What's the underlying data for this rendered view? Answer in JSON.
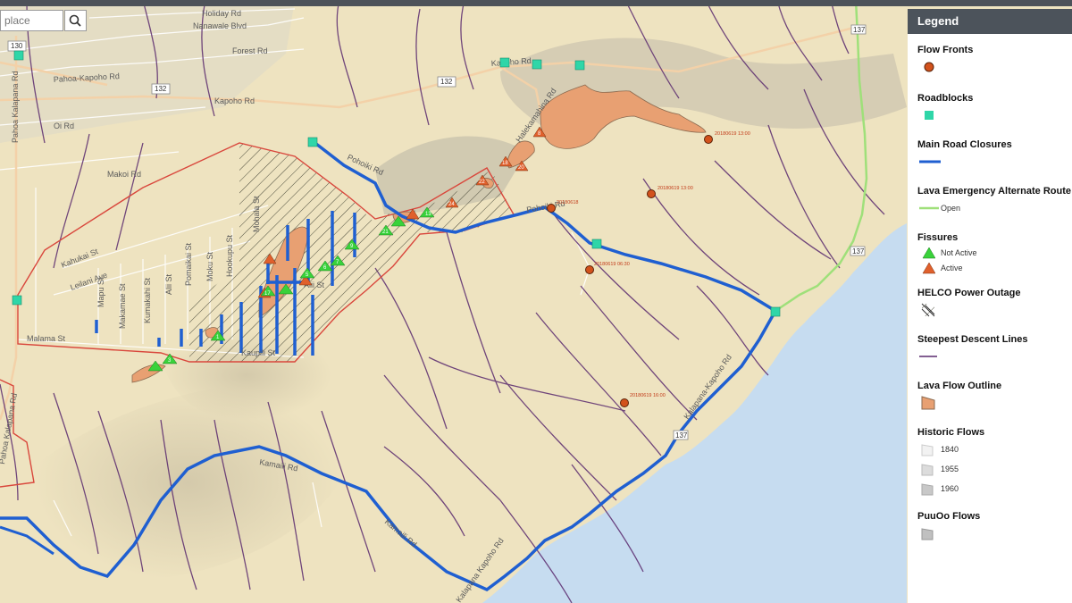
{
  "search": {
    "placeholder": "place"
  },
  "legend": {
    "title": "Legend",
    "flow_fronts": "Flow Fronts",
    "roadblocks": "Roadblocks",
    "main_road_closures": "Main Road Closures",
    "alternate_route": "Lava Emergency Alternate Route",
    "alternate_route_open": "Open",
    "fissures": "Fissures",
    "fissures_not_active": "Not Active",
    "fissures_active": "Active",
    "helco": "HELCO Power Outage",
    "steepest": "Steepest Descent Lines",
    "lava_outline": "Lava Flow Outline",
    "historic_flows": "Historic Flows",
    "historic_1840": "1840",
    "historic_1955": "1955",
    "historic_1960": "1960",
    "puuoo": "PuuOo Flows"
  },
  "colors": {
    "land": "#eee3c0",
    "ocean": "#c6dcf0",
    "road_closure": "#1f5fd1",
    "alt_route": "#9fe07a",
    "roadblock": "#2fd6a8",
    "flow_front": "#d2521c",
    "lava": "#e8a072",
    "fissure_not_active": "#39d23b",
    "fissure_active": "#e0602c",
    "helco_outline": "#d9473c",
    "steepest": "#5a2a6e"
  },
  "map": {
    "roads": {
      "holiday_rd": "Holiday Rd",
      "nanawale": "Nanawale Blvd",
      "forest": "Forest Rd",
      "pahoa_kapoho": "Pahoa-Kapoho Rd",
      "kapoho_rd_a": "Kapoho Rd",
      "kapoho_rd_b": "Kapoho Rd",
      "pahoa_kalapana": "Pahoa Kalapana Rd",
      "oi": "Oi Rd",
      "makoi": "Makoi Rd",
      "halekamahina": "Halekamahina Rd",
      "pohoiki": "Pohoiki Rd",
      "kahukai": "Kahukai St",
      "leilani": "Leilani Ave",
      "malama": "Malama St",
      "mohala": "Mohala St",
      "kaupili": "Kaupili St",
      "makamae": "Makamae St",
      "mapu": "Mapu St",
      "alii": "Alii St",
      "pomaikai": "Pomaikai St",
      "hookupu": "Hookupu St",
      "moku": "Moku St",
      "kumakahi": "Kumakahi St",
      "pohoiki2": "Pohoiki Rd",
      "kalapana_kapoho_a": "Kalapana-Kapoho Rd",
      "kalapana_kapoho_b": "Kalapana Kapoho Rd",
      "kamaili": "Kamaili Rd",
      "kamaili2": "Kamaili Rd"
    },
    "shields": [
      "130",
      "132",
      "132",
      "137",
      "137",
      "137"
    ],
    "fronts": [
      "20180619 13:00",
      "20180619 13:00",
      "20180618",
      "20180619 06:30",
      "20180619 16:00"
    ],
    "fissure_ids": [
      "8",
      "18",
      "20",
      "22",
      "24",
      "13",
      "21",
      "9",
      "7",
      "6",
      "5",
      "17",
      "1",
      "3"
    ]
  }
}
